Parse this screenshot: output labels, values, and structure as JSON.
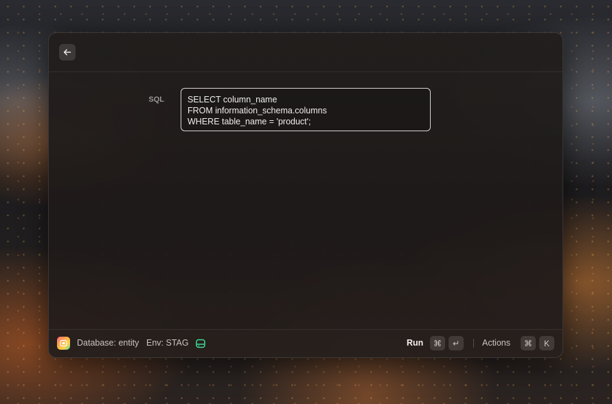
{
  "header": {
    "back_icon": "arrow-left-icon"
  },
  "form": {
    "sql_label": "SQL",
    "sql_value": "SELECT column_name\nFROM information_schema.columns\nWHERE table_name = 'product';"
  },
  "footer": {
    "app_icon": "database-icon",
    "database_text": "Database: entity",
    "env_text": "Env: STAG",
    "env_icon": "drive-icon",
    "run_label": "Run",
    "run_shortcut": [
      "⌘",
      "↵"
    ],
    "actions_label": "Actions",
    "actions_shortcut": [
      "⌘",
      "K"
    ]
  },
  "colors": {
    "accent_green": "#3ddc97",
    "field_border": "#d9d6d3"
  }
}
